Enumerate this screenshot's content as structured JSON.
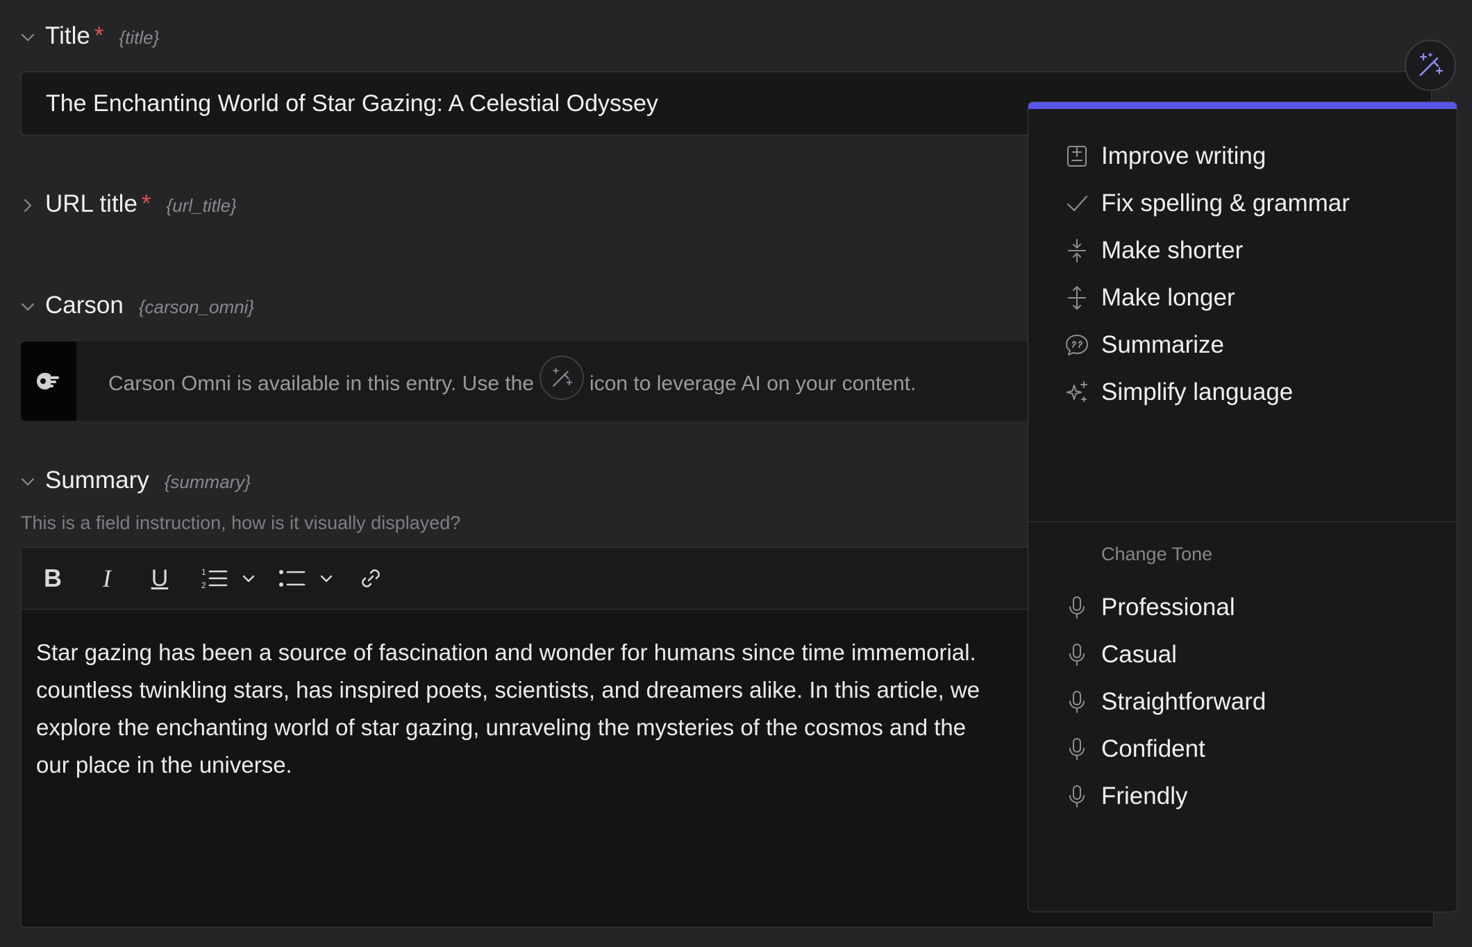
{
  "fields": {
    "title": {
      "label": "Title",
      "required_mark": "*",
      "handle": "{title}",
      "value": "The Enchanting World of Star Gazing: A Celestial Odyssey"
    },
    "url_title": {
      "label": "URL title",
      "required_mark": "*",
      "handle": "{url_title}"
    },
    "carson": {
      "label": "Carson",
      "handle": "{carson_omni}",
      "notice_before": "Carson Omni is available in this entry. Use the",
      "notice_after": "icon to leverage AI on your content."
    },
    "summary": {
      "label": "Summary",
      "handle": "{summary}",
      "instruction": "This is a field instruction, how is it visually displayed?",
      "lines": [
        "Star gazing has been a source of fascination and wonder for humans since time immemorial.",
        "countless twinkling stars, has inspired poets, scientists, and dreamers alike. In this article, we",
        "explore the enchanting world of star gazing, unraveling the mysteries of the cosmos and the",
        "our place in the universe."
      ]
    }
  },
  "toolbar": {
    "bold": "B",
    "italic": "I",
    "underline": "U",
    "icons": [
      "ordered-list-icon",
      "bullet-list-icon",
      "link-icon",
      "chevron-down-icon"
    ]
  },
  "ai_menu": {
    "accent": "#5656e8",
    "actions": [
      {
        "label": "Improve writing",
        "icon": "improve-writing-icon"
      },
      {
        "label": "Fix spelling & grammar",
        "icon": "check-icon"
      },
      {
        "label": "Make shorter",
        "icon": "make-shorter-icon"
      },
      {
        "label": "Make longer",
        "icon": "make-longer-icon"
      },
      {
        "label": "Summarize",
        "icon": "quote-bubble-icon"
      },
      {
        "label": "Simplify language",
        "icon": "sparkles-icon"
      }
    ],
    "tone_heading": "Change Tone",
    "tones": [
      {
        "label": "Professional",
        "icon": "microphone-icon"
      },
      {
        "label": "Casual",
        "icon": "microphone-icon"
      },
      {
        "label": "Straightforward",
        "icon": "microphone-icon"
      },
      {
        "label": "Confident",
        "icon": "microphone-icon"
      },
      {
        "label": "Friendly",
        "icon": "microphone-icon"
      }
    ]
  }
}
